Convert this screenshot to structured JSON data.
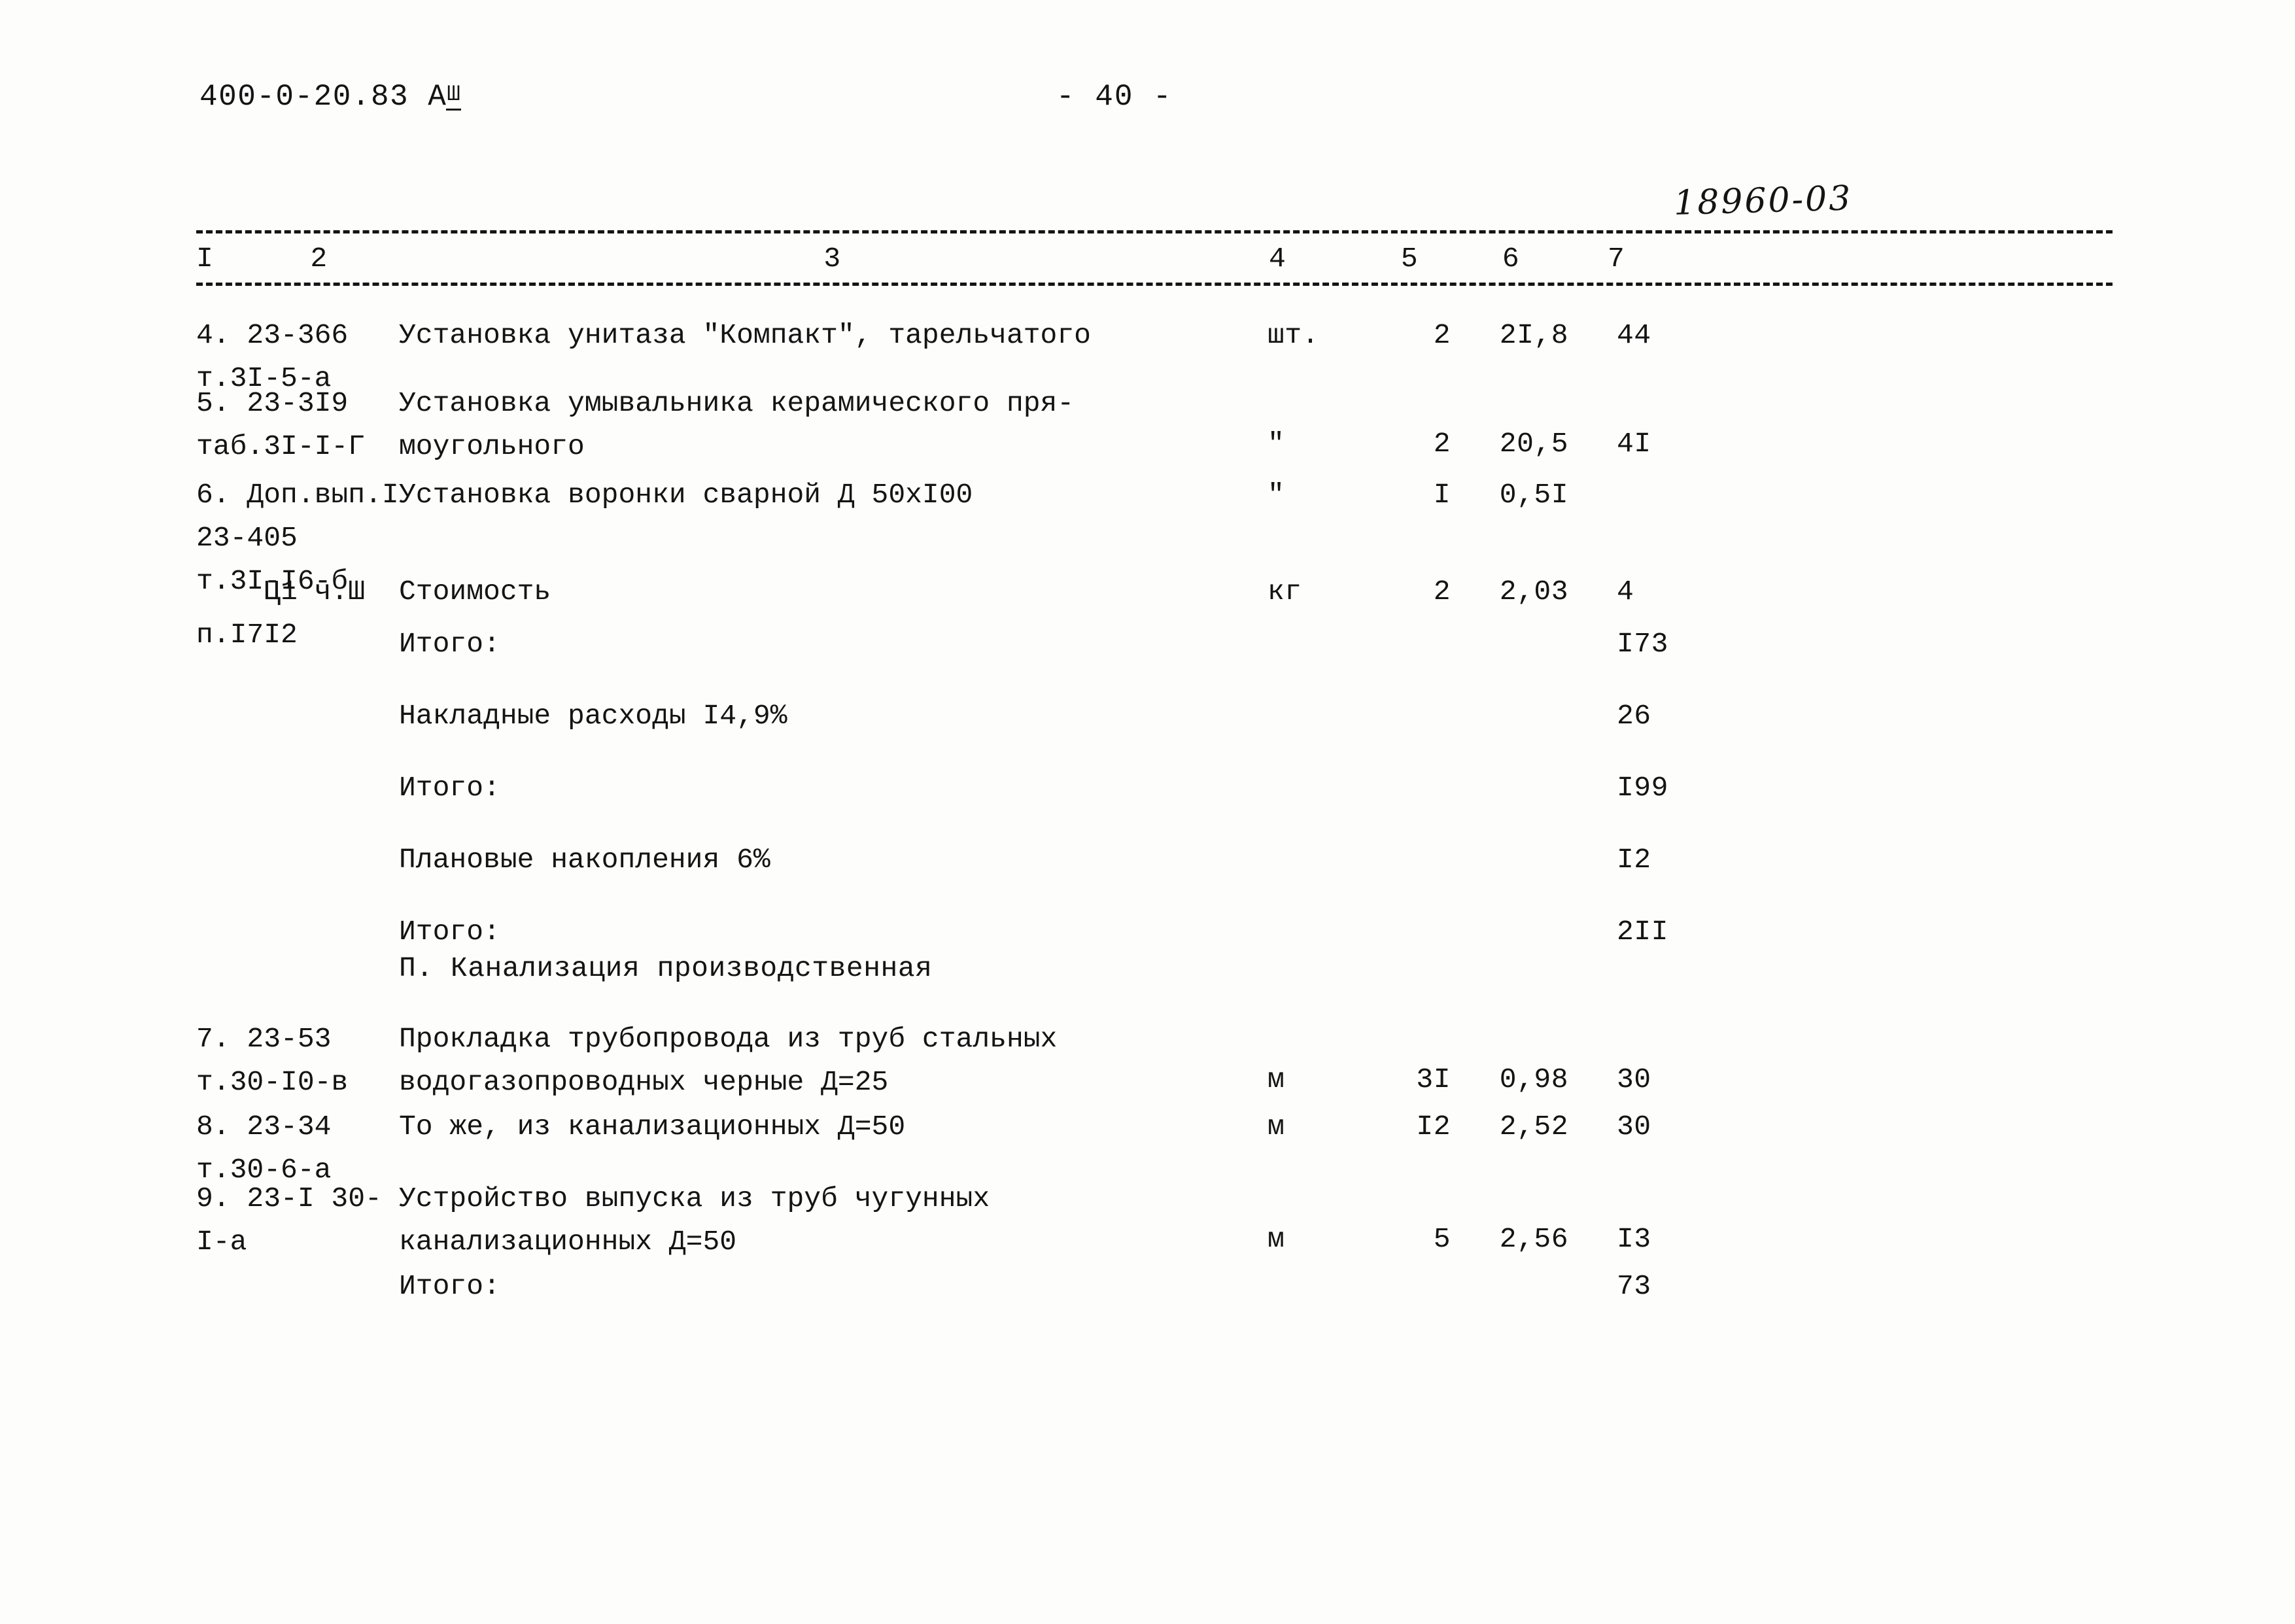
{
  "header": {
    "doc_code": "400-0-20.83 А",
    "doc_code_roman": "Ш",
    "page_number": "- 40 -",
    "handwritten_note": "18960-03"
  },
  "table": {
    "column_headers": [
      "I",
      "2",
      "3",
      "4",
      "5",
      "6",
      "7"
    ],
    "rows": [
      {
        "kind": "item",
        "num": "4.",
        "ref": "23-366 т.3I-5-а",
        "desc": "Установка унитаза \"Компакт\", тарельчатого",
        "unit": "шт.",
        "qty": "2",
        "price": "2I,8",
        "total": "44"
      },
      {
        "kind": "item",
        "num": "5.",
        "ref": "23-3I9 таб.3I-I-Г",
        "desc": "Установка умывальника керамического пря-\nмоугольного",
        "unit": "\"",
        "qty": "2",
        "price": "20,5",
        "total": "4I"
      },
      {
        "kind": "item",
        "num": "6.",
        "ref": "Доп.вып.I 23-405\nт.3I-I6-б",
        "desc": "Установка воронки сварной Д 50хI00",
        "unit": "\"",
        "qty": "I",
        "price": "0,5I",
        "total": ""
      },
      {
        "kind": "item",
        "num": "",
        "ref": "Ц1 ч.Ш п.I7I2",
        "desc": "Стоимость",
        "unit": "кг",
        "qty": "2",
        "price": "2,03",
        "total": "4"
      },
      {
        "kind": "summary",
        "num": "",
        "ref": "",
        "desc": "Итого:",
        "unit": "",
        "qty": "",
        "price": "",
        "total": "I73"
      },
      {
        "kind": "summary",
        "num": "",
        "ref": "",
        "desc": "Накладные расходы I4,9%",
        "unit": "",
        "qty": "",
        "price": "",
        "total": "26"
      },
      {
        "kind": "summary",
        "num": "",
        "ref": "",
        "desc": "Итого:",
        "unit": "",
        "qty": "",
        "price": "",
        "total": "I99"
      },
      {
        "kind": "summary",
        "num": "",
        "ref": "",
        "desc": "Плановые накопления 6%",
        "unit": "",
        "qty": "",
        "price": "",
        "total": "I2"
      },
      {
        "kind": "summary",
        "num": "",
        "ref": "",
        "desc": "Итого:",
        "unit": "",
        "qty": "",
        "price": "",
        "total": "2II"
      },
      {
        "kind": "section",
        "num": "",
        "ref": "",
        "desc": "П. Канализация производственная",
        "unit": "",
        "qty": "",
        "price": "",
        "total": ""
      },
      {
        "kind": "item",
        "num": "7.",
        "ref": "23-53 т.30-I0-в",
        "desc": "Прокладка трубопровода из труб стальных\nводогазопроводных черные Д=25",
        "unit": "м",
        "qty": "3I",
        "price": "0,98",
        "total": "30"
      },
      {
        "kind": "item",
        "num": "8.",
        "ref": "23-34 т.30-6-а",
        "desc": "То же, из канализационных Д=50",
        "unit": "м",
        "qty": "I2",
        "price": "2,52",
        "total": "30"
      },
      {
        "kind": "item",
        "num": "9.",
        "ref": "23-I 30-I-а",
        "desc": "Устройство выпуска из труб чугунных\nканализационных Д=50",
        "unit": "м",
        "qty": "5",
        "price": "2,56",
        "total": "I3"
      },
      {
        "kind": "summary",
        "num": "",
        "ref": "",
        "desc": "Итого:",
        "unit": "",
        "qty": "",
        "price": "",
        "total": "73"
      }
    ]
  }
}
